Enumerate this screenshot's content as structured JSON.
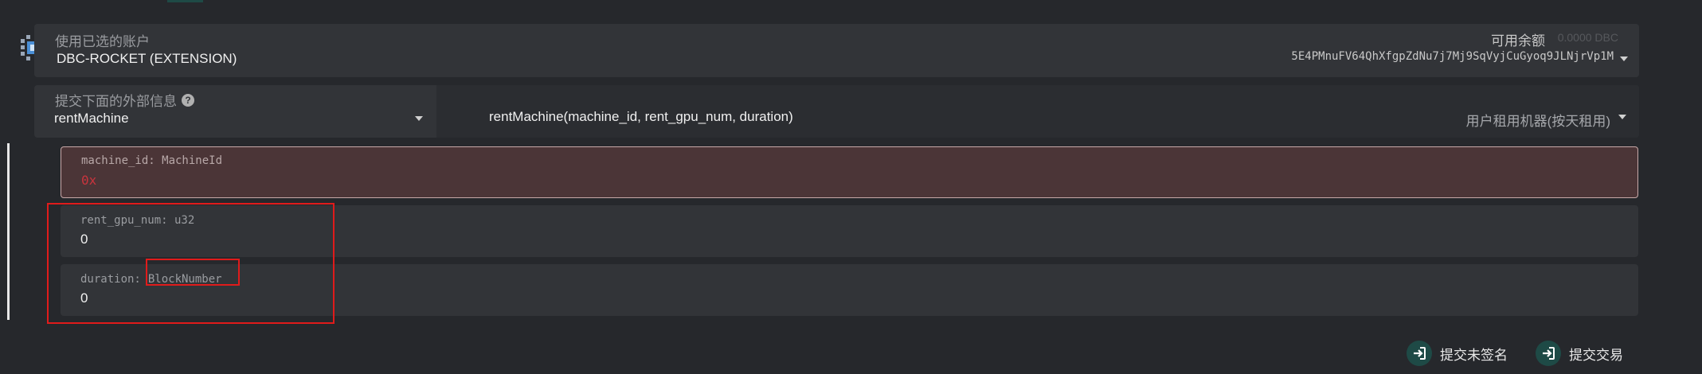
{
  "account": {
    "label": "使用已选的账户",
    "name": "DBC-ROCKET (EXTENSION)",
    "balance_label": "可用余额",
    "balance_value": "0.0000 DBC",
    "address": "5E4PMnuFV64QhXfgpZdNu7j7Mj9SqVyjCuGyoq9JLNjrVp1M"
  },
  "extrinsic": {
    "label": "提交下面的外部信息",
    "method": "rentMachine",
    "signature": "rentMachine(machine_id, rent_gpu_num, duration)",
    "description": "用户租用机器(按天租用)"
  },
  "params": [
    {
      "label": "machine_id: MachineId",
      "value": "0x"
    },
    {
      "label": "rent_gpu_num: u32",
      "value": "0"
    },
    {
      "label_prefix": "duration:",
      "label_type": "BlockNumber",
      "value": "0"
    }
  ],
  "actions": {
    "unsigned_label": "提交未签名",
    "submit_label": "提交交易"
  },
  "colors": {
    "error_bg": "#4b3537",
    "error_text": "#c9343d",
    "accent_icon": "#1e4a46",
    "highlight": "#e01b1b"
  }
}
